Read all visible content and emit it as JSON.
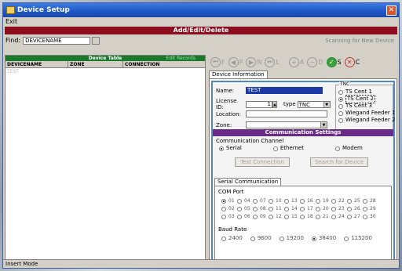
{
  "window": {
    "title": "Device Setup",
    "menu": [
      "Exit"
    ]
  },
  "banner": "Add/Edit/Delete",
  "find": {
    "label": "Find:",
    "value": "DEVICENAME",
    "scanning": "Scanning for New Device"
  },
  "device_table": {
    "title": "Device Table",
    "edit_link": "Edit Records",
    "columns": [
      "DEVICENAME",
      "ZONE",
      "CONNECTION"
    ],
    "rows": [
      {
        "name": "TEST",
        "zone": "",
        "connection": ""
      }
    ]
  },
  "toolbar": [
    {
      "icon": "first-icon",
      "label": "F"
    },
    {
      "icon": "prev-icon",
      "label": "P"
    },
    {
      "icon": "next-icon",
      "label": "N"
    },
    {
      "icon": "last-icon",
      "label": "L"
    },
    {
      "icon": "add-icon",
      "label": "A"
    },
    {
      "icon": "delete-icon",
      "label": "D"
    },
    {
      "icon": "save-icon",
      "label": "S"
    },
    {
      "icon": "cancel-icon",
      "label": "C"
    }
  ],
  "tab": "Device Information",
  "form": {
    "name_label": "Name:",
    "name_value": "TEST",
    "license_label": "License ID:",
    "license_value": "1",
    "type_label": "type",
    "type_value": "TNC",
    "location_label": "Location:",
    "location_value": "",
    "zone_label": "Zone:",
    "zone_value": ""
  },
  "tnc": {
    "legend": "TNC",
    "options": [
      "TS Cent 1",
      "TS Cent 2",
      "TS Cent 3",
      "Wiegand Feeder 1",
      "Wiegand Feeder 2"
    ],
    "selected": "TS Cent 2"
  },
  "comm": {
    "title": "Communication Settings",
    "channel_label": "Communication Channel",
    "channels": [
      "Serial",
      "Ethernet",
      "Modem"
    ],
    "selected": "Serial",
    "test_button": "Test Connection",
    "search_button": "Search for Device"
  },
  "serial": {
    "tab": "Serial Communication",
    "com_label": "COM Port",
    "ports": [
      "01",
      "04",
      "07",
      "10",
      "13",
      "16",
      "19",
      "22",
      "25",
      "28",
      "02",
      "05",
      "08",
      "11",
      "14",
      "17",
      "20",
      "23",
      "26",
      "29",
      "03",
      "06",
      "09",
      "12",
      "15",
      "18",
      "21",
      "24",
      "27",
      "30"
    ],
    "selected_port": "01",
    "baud_label": "Baud Rate",
    "bauds": [
      "2400",
      "9600",
      "19200",
      "38400",
      "115200"
    ],
    "selected_baud": "38400"
  },
  "status": "Insert Mode"
}
